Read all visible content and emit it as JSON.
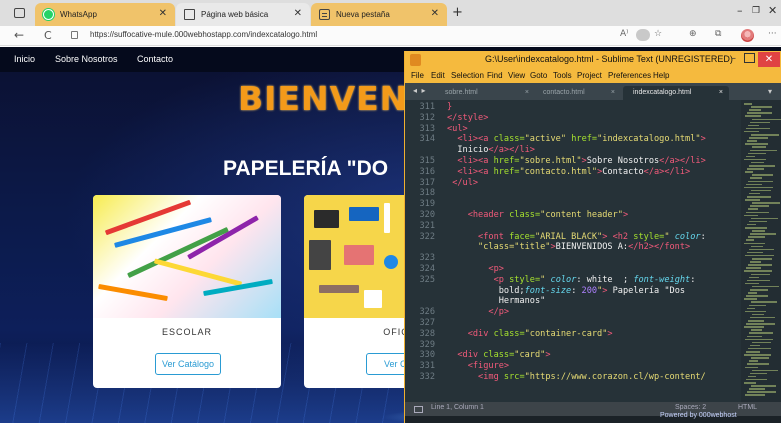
{
  "browser": {
    "tabs": [
      {
        "title": "WhatsApp",
        "icon": "whatsapp-icon"
      },
      {
        "title": "Página web básica",
        "icon": "page-icon"
      },
      {
        "title": "Nueva pestaña",
        "icon": "new-tab-icon"
      }
    ],
    "tab_close": "✕",
    "new_tab": "+",
    "window_controls": {
      "minimize": "–",
      "maximize": "❐",
      "close": "✕"
    },
    "url": "https://suffocative-mule.000webhostapp.com/indexcatalogo.html",
    "back": "←",
    "reload": "C",
    "tools": {
      "read_aloud": "A⁾",
      "favorites": "☆",
      "extensions": "⊕",
      "collections": "⧉",
      "more": "···"
    }
  },
  "website": {
    "nav": [
      "Inicio",
      "Sobre Nosotros",
      "Contacto"
    ],
    "hero_title": "BIENVEN",
    "hero_subtitle": "PAPELERÍA \"DO",
    "cards": [
      {
        "title": "ESCOLAR",
        "button": "Ver Catálogo"
      },
      {
        "title": "OFIC",
        "button": "Ver Cat"
      }
    ],
    "footer_text": "Powered by 000webhost"
  },
  "sublime": {
    "title": "G:\\User\\indexcatalogo.html - Sublime Text (UNREGISTERED)",
    "menu": [
      "File",
      "Edit",
      "Selection",
      "Find",
      "View",
      "Goto",
      "Tools",
      "Project",
      "Preferences",
      "Help"
    ],
    "tabs": [
      "sobre.html",
      "contacto.html",
      "indexcatalogo.html"
    ],
    "tab_close": "×",
    "nav_arrows": "◂ ▸",
    "dropdown": "▾",
    "status": {
      "position": "Line 1, Column 1",
      "spaces": "Spaces: 2",
      "syntax": "HTML"
    },
    "lines": [
      {
        "n": "311",
        "segs": [
          {
            "c": "t-tag",
            "t": "}"
          }
        ]
      },
      {
        "n": "312",
        "segs": [
          {
            "c": "t-tag",
            "t": "</style>"
          }
        ]
      },
      {
        "n": "313",
        "segs": [
          {
            "c": "t-tag",
            "t": "<ul>"
          }
        ]
      },
      {
        "n": "314",
        "segs": [
          {
            "c": "t-txt",
            "t": "  "
          },
          {
            "c": "t-tag",
            "t": "<li><a "
          },
          {
            "c": "t-attr",
            "t": "class="
          },
          {
            "c": "t-str",
            "t": "\"active\""
          },
          {
            "c": "t-txt",
            "t": " "
          },
          {
            "c": "t-attr",
            "t": "href="
          },
          {
            "c": "t-str",
            "t": "\"indexcatalogo.html\""
          },
          {
            "c": "t-tag",
            "t": ">"
          }
        ]
      },
      {
        "n": "",
        "segs": [
          {
            "c": "t-txt",
            "t": "  Inicio"
          },
          {
            "c": "t-tag",
            "t": "</a></li>"
          }
        ]
      },
      {
        "n": "315",
        "segs": [
          {
            "c": "t-txt",
            "t": "  "
          },
          {
            "c": "t-tag",
            "t": "<li><a "
          },
          {
            "c": "t-attr",
            "t": "href="
          },
          {
            "c": "t-str",
            "t": "\"sobre.html\""
          },
          {
            "c": "t-tag",
            "t": ">"
          },
          {
            "c": "t-txt",
            "t": "Sobre Nosotros"
          },
          {
            "c": "t-tag",
            "t": "</a></li>"
          }
        ]
      },
      {
        "n": "316",
        "segs": [
          {
            "c": "t-txt",
            "t": "  "
          },
          {
            "c": "t-tag",
            "t": "<li><a "
          },
          {
            "c": "t-attr",
            "t": "href="
          },
          {
            "c": "t-str",
            "t": "\"contacto.html\""
          },
          {
            "c": "t-tag",
            "t": ">"
          },
          {
            "c": "t-txt",
            "t": "Contacto"
          },
          {
            "c": "t-tag",
            "t": "</a></li>"
          }
        ]
      },
      {
        "n": "317",
        "segs": [
          {
            "c": "t-txt",
            "t": " "
          },
          {
            "c": "t-tag",
            "t": "</ul>"
          }
        ]
      },
      {
        "n": "318",
        "segs": []
      },
      {
        "n": "319",
        "segs": []
      },
      {
        "n": "320",
        "segs": [
          {
            "c": "t-txt",
            "t": "    "
          },
          {
            "c": "t-tag",
            "t": "<header "
          },
          {
            "c": "t-attr",
            "t": "class="
          },
          {
            "c": "t-str",
            "t": "\"content header\""
          },
          {
            "c": "t-tag",
            "t": ">"
          }
        ]
      },
      {
        "n": "321",
        "segs": []
      },
      {
        "n": "322",
        "segs": [
          {
            "c": "t-txt",
            "t": "      "
          },
          {
            "c": "t-tag",
            "t": "<font "
          },
          {
            "c": "t-attr",
            "t": "face="
          },
          {
            "c": "t-str",
            "t": "\"ARIAL BLACK\""
          },
          {
            "c": "t-tag",
            "t": "> <h2 "
          },
          {
            "c": "t-attr",
            "t": "style="
          },
          {
            "c": "t-str",
            "t": "\" "
          },
          {
            "c": "t-css",
            "t": "color"
          },
          {
            "c": "t-txt",
            "t": ":"
          }
        ]
      },
      {
        "n": "",
        "segs": [
          {
            "c": "t-txt",
            "t": "      "
          },
          {
            "c": "t-str",
            "t": "\"class=\"title\""
          },
          {
            "c": "t-tag",
            "t": ">"
          },
          {
            "c": "t-txt",
            "t": "BIENVENIDOS A:"
          },
          {
            "c": "t-tag",
            "t": "</h2></font>"
          }
        ]
      },
      {
        "n": "323",
        "segs": []
      },
      {
        "n": "324",
        "segs": [
          {
            "c": "t-txt",
            "t": "        "
          },
          {
            "c": "t-tag",
            "t": "<p>"
          }
        ]
      },
      {
        "n": "325",
        "segs": [
          {
            "c": "t-txt",
            "t": "         "
          },
          {
            "c": "t-tag",
            "t": "<p "
          },
          {
            "c": "t-attr",
            "t": "style="
          },
          {
            "c": "t-str",
            "t": "\" "
          },
          {
            "c": "t-css",
            "t": "color"
          },
          {
            "c": "t-txt",
            "t": ": white  ; "
          },
          {
            "c": "t-css",
            "t": "font-weight"
          },
          {
            "c": "t-txt",
            "t": ":"
          }
        ]
      },
      {
        "n": "",
        "segs": [
          {
            "c": "t-txt",
            "t": "          bold;"
          },
          {
            "c": "t-css",
            "t": "font-size"
          },
          {
            "c": "t-txt",
            "t": ": "
          },
          {
            "c": "t-val",
            "t": "200"
          },
          {
            "c": "t-str",
            "t": "\""
          },
          {
            "c": "t-tag",
            "t": ">"
          },
          {
            "c": "t-txt",
            "t": " Papelería \"Dos"
          }
        ]
      },
      {
        "n": "",
        "segs": [
          {
            "c": "t-txt",
            "t": "          Hermanos\""
          }
        ]
      },
      {
        "n": "326",
        "segs": [
          {
            "c": "t-txt",
            "t": "        "
          },
          {
            "c": "t-tag",
            "t": "</p>"
          }
        ]
      },
      {
        "n": "327",
        "segs": []
      },
      {
        "n": "328",
        "segs": [
          {
            "c": "t-txt",
            "t": "    "
          },
          {
            "c": "t-tag",
            "t": "<div "
          },
          {
            "c": "t-attr",
            "t": "class="
          },
          {
            "c": "t-str",
            "t": "\"container-card\""
          },
          {
            "c": "t-tag",
            "t": ">"
          }
        ]
      },
      {
        "n": "329",
        "segs": []
      },
      {
        "n": "330",
        "segs": [
          {
            "c": "t-txt",
            "t": "  "
          },
          {
            "c": "t-tag",
            "t": "<div "
          },
          {
            "c": "t-attr",
            "t": "class="
          },
          {
            "c": "t-str",
            "t": "\"card\""
          },
          {
            "c": "t-tag",
            "t": ">"
          }
        ]
      },
      {
        "n": "331",
        "segs": [
          {
            "c": "t-txt",
            "t": "    "
          },
          {
            "c": "t-tag",
            "t": "<figure>"
          }
        ]
      },
      {
        "n": "332",
        "segs": [
          {
            "c": "t-txt",
            "t": "      "
          },
          {
            "c": "t-tag",
            "t": "<img "
          },
          {
            "c": "t-attr",
            "t": "src="
          },
          {
            "c": "t-str",
            "t": "\"https://www.corazon.cl/wp-content/"
          }
        ]
      }
    ]
  },
  "colors": {
    "tab_active": "#f0c36a",
    "sublime_bg": "#263238",
    "sublime_titlebar": "#f5ba3e",
    "hero_orange": "#f39a1a",
    "link_blue": "#2a9bd3"
  }
}
